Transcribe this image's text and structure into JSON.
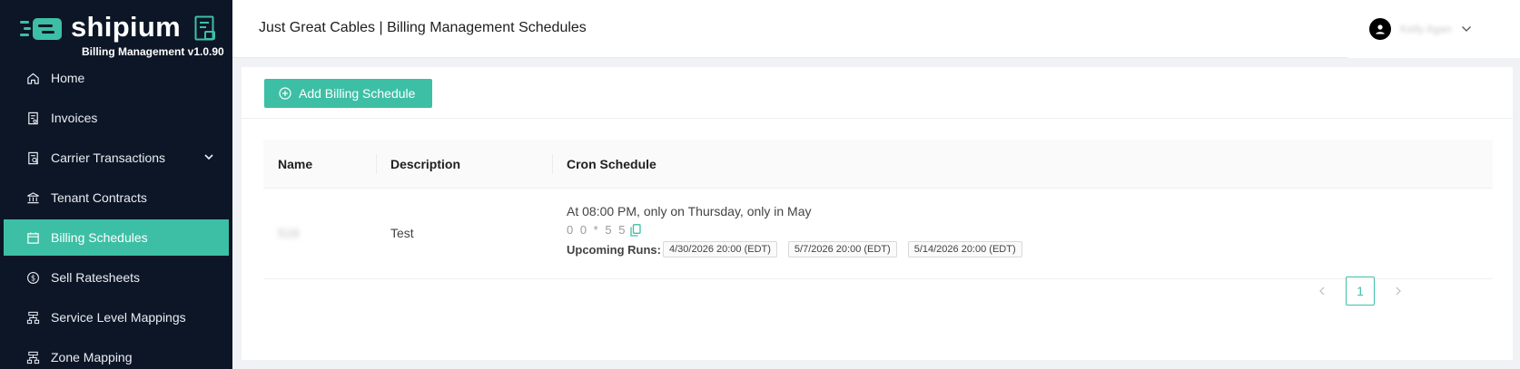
{
  "brand": {
    "name": "shipium",
    "version": "Billing Management v1.0.90"
  },
  "sidebar": {
    "items": [
      {
        "label": "Home",
        "icon": "home-icon"
      },
      {
        "label": "Invoices",
        "icon": "invoice-icon"
      },
      {
        "label": "Carrier Transactions",
        "icon": "transactions-icon",
        "has_caret": true
      },
      {
        "label": "Tenant Contracts",
        "icon": "bank-icon"
      },
      {
        "label": "Billing Schedules",
        "icon": "calendar-icon",
        "active": true
      },
      {
        "label": "Sell Ratesheets",
        "icon": "dollar-icon"
      },
      {
        "label": "Service Level Mappings",
        "icon": "cluster-icon"
      },
      {
        "label": "Zone Mapping",
        "icon": "cluster-icon"
      }
    ]
  },
  "header": {
    "title": "Just Great Cables | Billing Management Schedules",
    "user_name": "Kelly Agan"
  },
  "toolbar": {
    "add_label": "Add Billing Schedule"
  },
  "table": {
    "columns": [
      "Name",
      "Description",
      "Cron Schedule"
    ],
    "rows": [
      {
        "name": "516",
        "description": "Test",
        "cron_description": "At 08:00 PM, only on Thursday, only in May",
        "cron_expression": "0 0 * 5 5",
        "upcoming_label": "Upcoming Runs:",
        "upcoming_runs": [
          "4/30/2026 20:00 (EDT)",
          "5/7/2026 20:00 (EDT)",
          "5/14/2026 20:00 (EDT)"
        ]
      }
    ]
  },
  "pagination": {
    "current_page": "1"
  },
  "colors": {
    "sidebar_bg": "#0d1626",
    "accent": "#3dbfa5"
  }
}
